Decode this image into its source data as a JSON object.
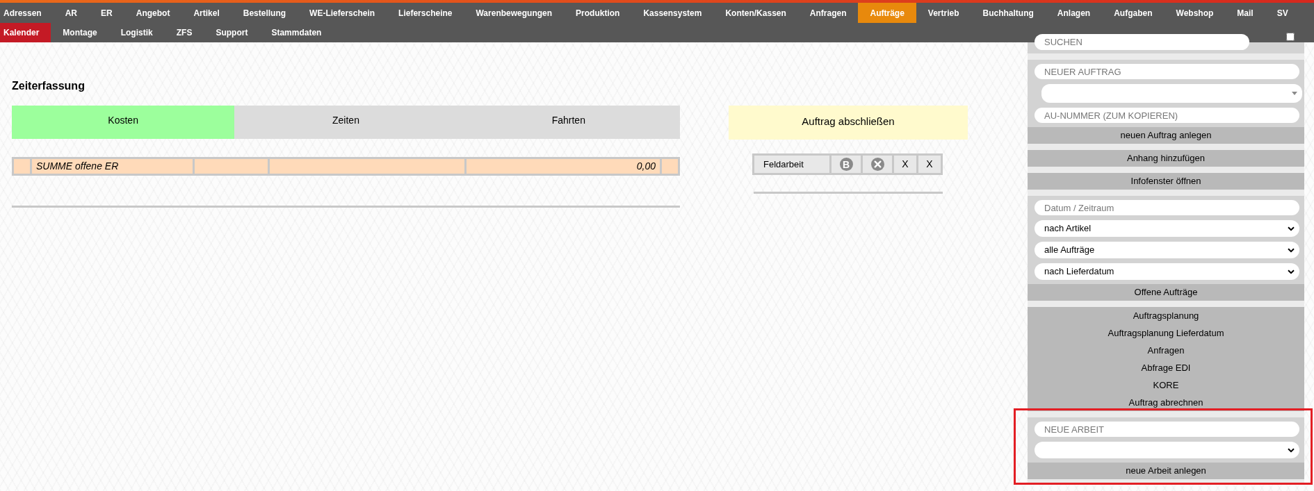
{
  "nav": {
    "rows": [
      [
        {
          "label": "Adressen",
          "kind": "link",
          "selected": false
        },
        {
          "label": "AR",
          "kind": "link",
          "selected": false
        },
        {
          "label": "ER",
          "kind": "link",
          "selected": false
        },
        {
          "label": "Angebot",
          "kind": "link",
          "selected": false
        },
        {
          "label": "Artikel",
          "kind": "link",
          "selected": false
        },
        {
          "label": "Bestellung",
          "kind": "link",
          "selected": false
        },
        {
          "label": "WE-Lieferschein",
          "kind": "link",
          "selected": false
        },
        {
          "label": "Lieferscheine",
          "kind": "link",
          "selected": false
        },
        {
          "label": "Warenbewegungen",
          "kind": "link",
          "selected": false
        },
        {
          "label": "Produktion",
          "kind": "link",
          "selected": false
        },
        {
          "label": "Kassensystem",
          "kind": "link",
          "selected": false
        },
        {
          "label": "Konten/Kassen",
          "kind": "link",
          "selected": false
        },
        {
          "label": "Anfragen",
          "kind": "link",
          "selected": false
        },
        {
          "label": "Aufträge",
          "kind": "link",
          "selected": true
        },
        {
          "label": "Vertrieb",
          "kind": "link",
          "selected": false
        },
        {
          "label": "Buchhaltung",
          "kind": "link",
          "selected": false
        },
        {
          "label": "Anlagen",
          "kind": "link",
          "selected": false
        },
        {
          "label": "Aufgaben",
          "kind": "link",
          "selected": false
        },
        {
          "label": "Webshop",
          "kind": "link",
          "selected": false
        },
        {
          "label": "Mail",
          "kind": "link",
          "selected": false
        },
        {
          "label": "SV",
          "kind": "link",
          "selected": false
        }
      ],
      [
        {
          "label": "Kalender",
          "kind": "highlight",
          "selected": false
        },
        {
          "label": "Montage",
          "kind": "link",
          "selected": false
        },
        {
          "label": "Logistik",
          "kind": "link",
          "selected": false
        },
        {
          "label": "ZFS",
          "kind": "link",
          "selected": false
        },
        {
          "label": "Support",
          "kind": "link",
          "selected": false
        },
        {
          "label": "Stammdaten",
          "kind": "link",
          "selected": false
        }
      ]
    ],
    "checkbox": {
      "checked": false
    }
  },
  "main": {
    "title": "Zeiterfassung",
    "tabs": [
      {
        "label": "Kosten",
        "selected": true
      },
      {
        "label": "Zeiten",
        "selected": false
      },
      {
        "label": "Fahrten",
        "selected": false
      }
    ],
    "summary_row": {
      "label": "SUMME offene ER",
      "amount": "0,00"
    },
    "close_order": {
      "label": "Auftrag abschließen"
    },
    "task": {
      "label": "Feldarbeit",
      "actions": [
        {
          "kind": "letter",
          "label": "B"
        },
        {
          "kind": "close"
        },
        {
          "kind": "text",
          "label": "X"
        },
        {
          "kind": "text",
          "label": "X"
        }
      ]
    }
  },
  "sidebar": {
    "search": {
      "placeholder": "SUCHEN"
    },
    "sections": [
      {
        "highlighted": false,
        "items": [
          {
            "kind": "input",
            "placeholder": "NEUER AUFTRAG"
          },
          {
            "kind": "combobox"
          },
          {
            "kind": "input",
            "placeholder": "AU-NUMMER (ZUM KOPIEREN)"
          },
          {
            "kind": "button",
            "label": "neuen Auftrag anlegen"
          }
        ]
      },
      {
        "highlighted": false,
        "items": [
          {
            "kind": "button",
            "label": "Anhang hinzufügen"
          }
        ]
      },
      {
        "highlighted": false,
        "items": [
          {
            "kind": "button",
            "label": "Infofenster öffnen"
          }
        ]
      },
      {
        "highlighted": false,
        "items": [
          {
            "kind": "input",
            "placeholder": "Datum / Zeitraum"
          },
          {
            "kind": "select",
            "value": "nach Artikel"
          },
          {
            "kind": "select",
            "value": "alle Aufträge"
          },
          {
            "kind": "select",
            "value": "nach Lieferdatum"
          },
          {
            "kind": "button",
            "label": "Offene Aufträge"
          }
        ]
      },
      {
        "highlighted": false,
        "items": [
          {
            "kind": "link",
            "label": "Auftragsplanung"
          },
          {
            "kind": "link",
            "label": "Auftragsplanung Lieferdatum"
          },
          {
            "kind": "link",
            "label": "Anfragen"
          },
          {
            "kind": "link",
            "label": "Abfrage EDI"
          },
          {
            "kind": "link",
            "label": "KORE"
          },
          {
            "kind": "link",
            "label": "Auftrag abrechnen"
          }
        ]
      },
      {
        "highlighted": true,
        "items": [
          {
            "kind": "input",
            "placeholder": "NEUE ARBEIT"
          },
          {
            "kind": "select"
          },
          {
            "kind": "button",
            "label": "neue Arbeit anlegen"
          }
        ]
      }
    ]
  }
}
